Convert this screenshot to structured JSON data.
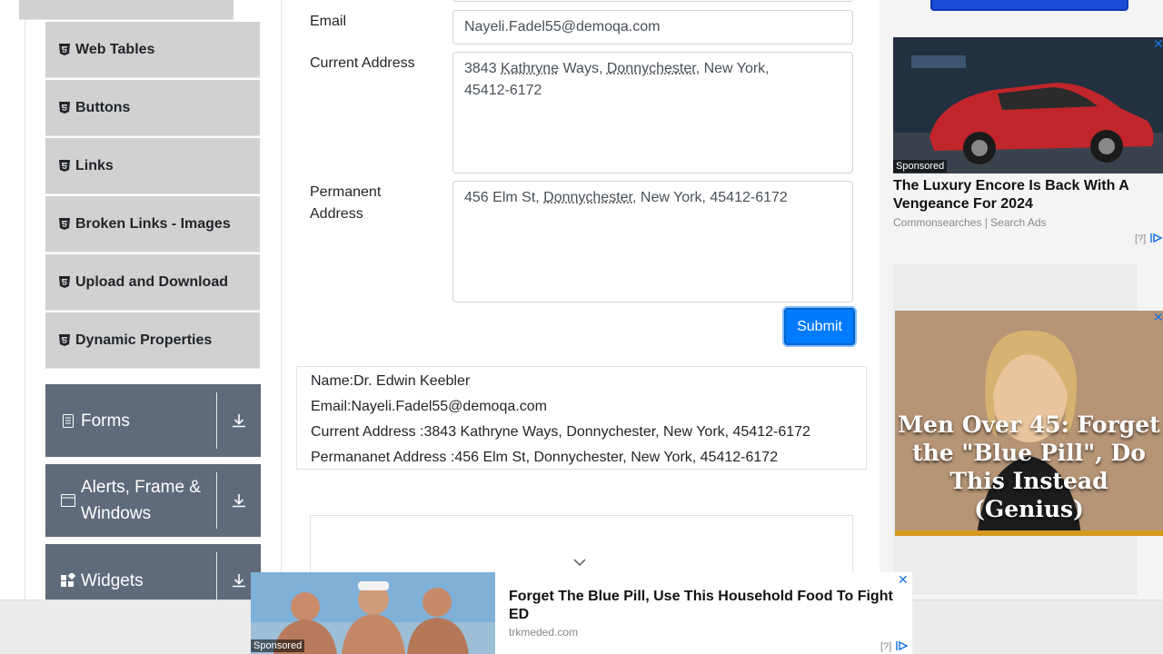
{
  "sidebar": {
    "items": [
      {
        "label": ""
      },
      {
        "label": "Web Tables"
      },
      {
        "label": "Buttons"
      },
      {
        "label": "Links"
      },
      {
        "label": "Broken Links - Images"
      },
      {
        "label": "Upload and Download"
      },
      {
        "label": "Dynamic Properties"
      }
    ],
    "groups": [
      {
        "label": "Forms",
        "icon": "form-icon"
      },
      {
        "label": "Alerts, Frame & Windows",
        "icon": "window-icon"
      },
      {
        "label": "Widgets",
        "icon": "widgets-icon"
      }
    ]
  },
  "form": {
    "email_label": "Email",
    "email_value": "Nayeli.Fadel55@demoqa.com",
    "current_address_label": "Current Address",
    "current_address_value": {
      "num": "3843 ",
      "street_name": "Kathryne",
      "street_suffix": " Ways, ",
      "city": "Donnychester",
      "rest_line1": ", New York,",
      "line2": "45412-6172"
    },
    "permanent_address_label": "Permanent Address",
    "permanent_address_value": {
      "prefix": "456 Elm St, ",
      "city": "Donnychester",
      "suffix": ", New York, 45412-6172"
    },
    "submit_label": "Submit"
  },
  "output": {
    "name": "Name:Dr. Edwin Keebler",
    "email": "Email:Nayeli.Fadel55@demoqa.com",
    "current_address": "Current Address :3843 Kathryne Ways, Donnychester, New York, 45412-6172",
    "permanent_address": "Permananet Address :456 Elm St, Donnychester, New York, 45412-6172"
  },
  "ads": {
    "car": {
      "sponsored": "Sponsored",
      "title": "The Luxury Encore Is Back With A Vengeance For 2024",
      "source": "Commonsearches | Search Ads",
      "help": "[?]"
    },
    "blonde": {
      "headline": "Men Over 45: Forget the \"Blue Pill\", Do This Instead (Genius)"
    },
    "bottom": {
      "sponsored": "Sponsored",
      "title": "Forget The Blue Pill, Use This Household Food To Fight ED",
      "source": "trkmeded.com",
      "help": "[?]"
    },
    "close_glyph": "✕"
  }
}
